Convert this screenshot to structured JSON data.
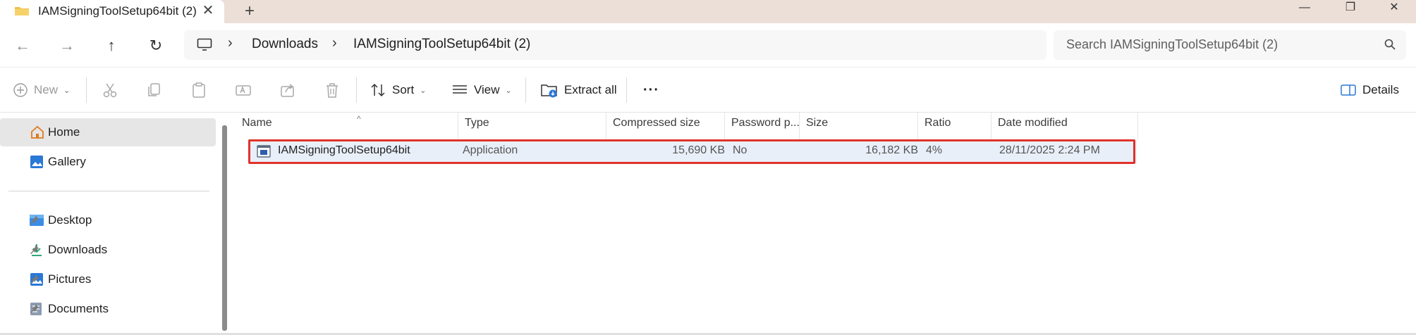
{
  "window": {
    "tab_title": "IAMSigningToolSetup64bit (2)",
    "tab_close_glyph": "✕",
    "new_tab_glyph": "+",
    "minimize_glyph": "—",
    "maximize_glyph": "❐",
    "close_glyph": "✕"
  },
  "navigation": {
    "back_glyph": "←",
    "forward_glyph": "→",
    "up_glyph": "↑",
    "refresh_glyph": "↻",
    "breadcrumb": [
      "Downloads",
      "IAMSigningToolSetup64bit (2)"
    ],
    "breadcrumb_separator": "›",
    "search_placeholder": "Search IAMSigningToolSetup64bit (2)"
  },
  "toolbar": {
    "new_label": "New",
    "sort_label": "Sort",
    "view_label": "View",
    "extract_label": "Extract all",
    "more_glyph": "···",
    "details_label": "Details",
    "chevron_glyph": "⌄"
  },
  "sidebar": {
    "items": [
      {
        "label": "Home",
        "icon": "home-icon",
        "selected": true
      },
      {
        "label": "Gallery",
        "icon": "gallery-icon"
      },
      {
        "label": "Desktop",
        "icon": "desktop-icon",
        "pinned": true
      },
      {
        "label": "Downloads",
        "icon": "download-icon",
        "pinned": true
      },
      {
        "label": "Pictures",
        "icon": "pictures-icon",
        "pinned": true
      },
      {
        "label": "Documents",
        "icon": "documents-icon",
        "pinned": true
      }
    ]
  },
  "table": {
    "sort_caret": "^",
    "columns": [
      "Name",
      "Type",
      "Compressed size",
      "Password p...",
      "Size",
      "Ratio",
      "Date modified"
    ],
    "rows": [
      {
        "name": "IAMSigningToolSetup64bit",
        "type": "Application",
        "compressed_size": "15,690 KB",
        "password": "No",
        "size": "16,182 KB",
        "ratio": "4%",
        "date_modified": "28/11/2025 2:24 PM"
      }
    ]
  },
  "colors": {
    "tab_strip": "#ecdfd8",
    "row_highlight_border": "#e0332b",
    "row_selected": "#e9eff9"
  }
}
